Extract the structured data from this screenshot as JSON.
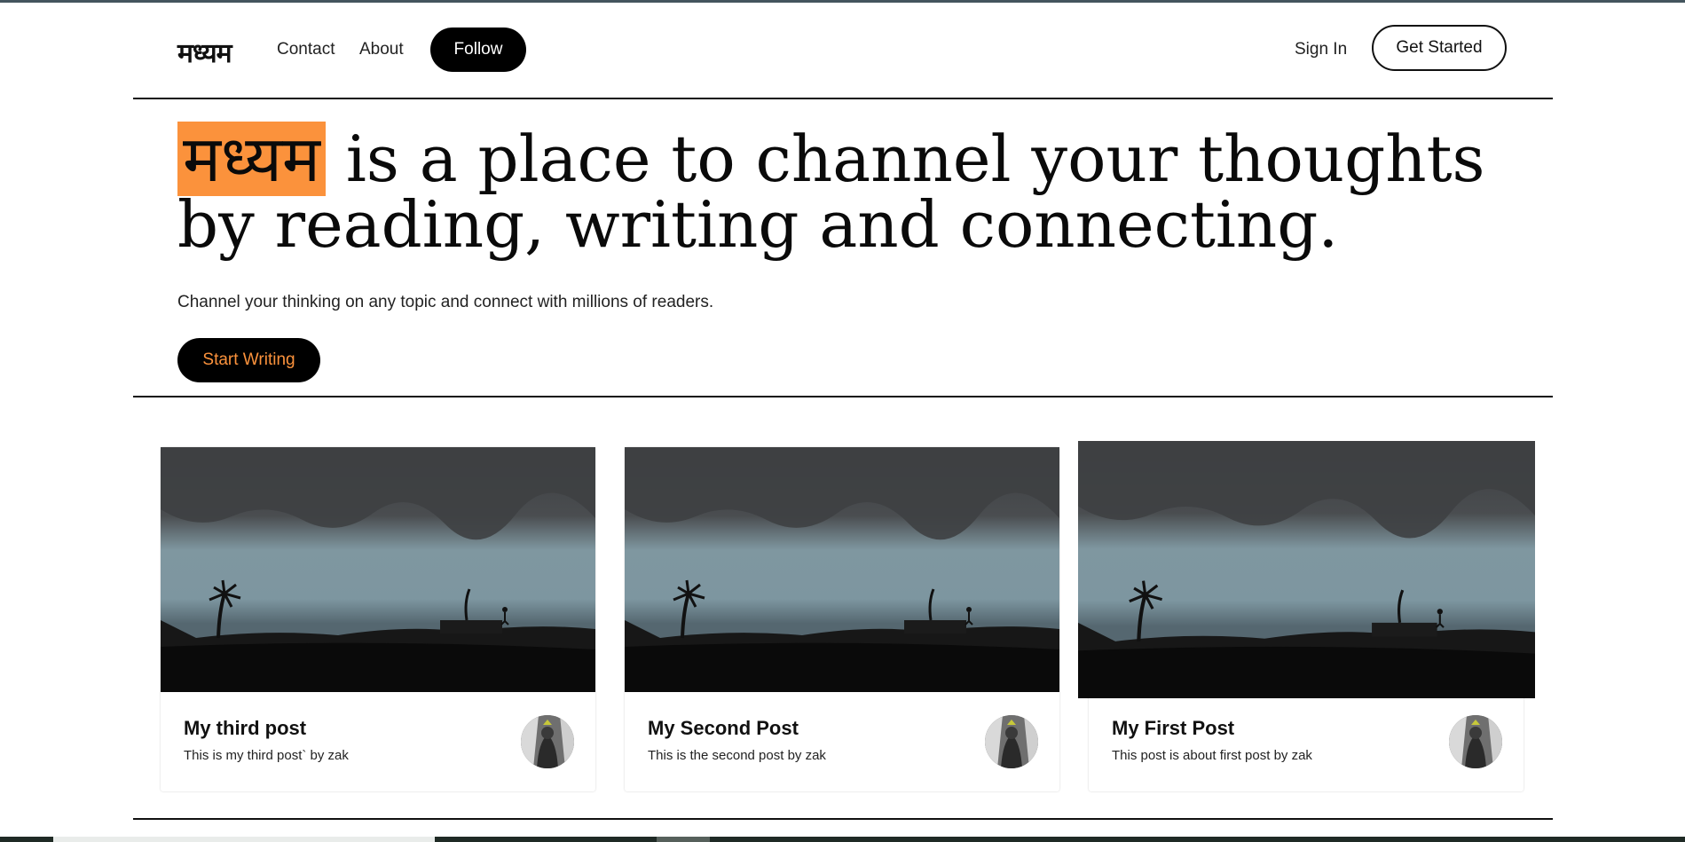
{
  "nav": {
    "brand": "मध्यम",
    "contact": "Contact",
    "about": "About",
    "follow": "Follow",
    "sign_in": "Sign In",
    "get_started": "Get Started"
  },
  "hero": {
    "brand_highlight": "मध्यम",
    "title_rest": " is a place to channel your thoughts by reading, writing and connecting.",
    "subtitle": "Channel your thinking on any topic and connect with millions of readers.",
    "cta": "Start Writing"
  },
  "posts": [
    {
      "title": "My third post",
      "description": "This is my third post` by zak"
    },
    {
      "title": "My Second Post",
      "description": "This is the second post by zak"
    },
    {
      "title": "My First Post",
      "description": "This post is about first post by zak"
    }
  ],
  "colors": {
    "accent": "#fb923c",
    "button_dark": "#000000",
    "text": "#111111"
  }
}
